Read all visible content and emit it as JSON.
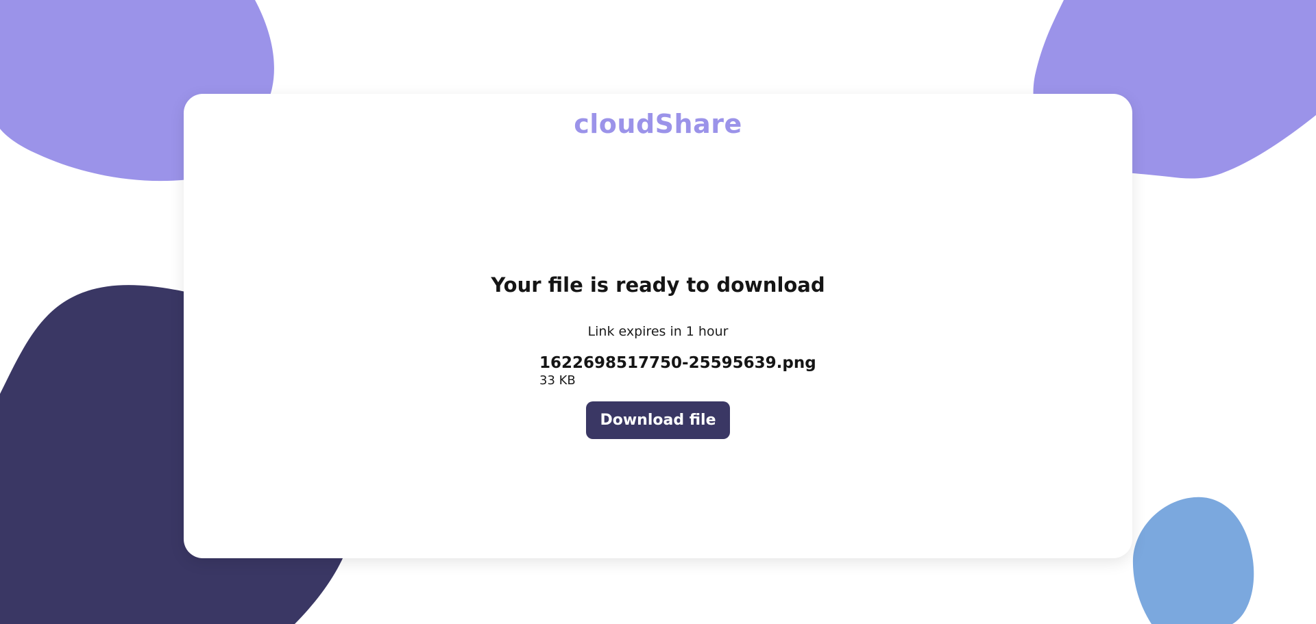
{
  "colors": {
    "brand": "#9b93e9",
    "button_bg": "#3a3764",
    "blob_purple": "#9b93e9",
    "blob_navy": "#3a3764",
    "blob_blue": "#7ba8de"
  },
  "header": {
    "brand": "cloudShare"
  },
  "download": {
    "headline": "Your file is ready to download",
    "expiry_text": "Link expires in 1 hour",
    "file_name": "1622698517750-25595639.png",
    "file_size": "33 KB",
    "button_label": "Download file"
  }
}
